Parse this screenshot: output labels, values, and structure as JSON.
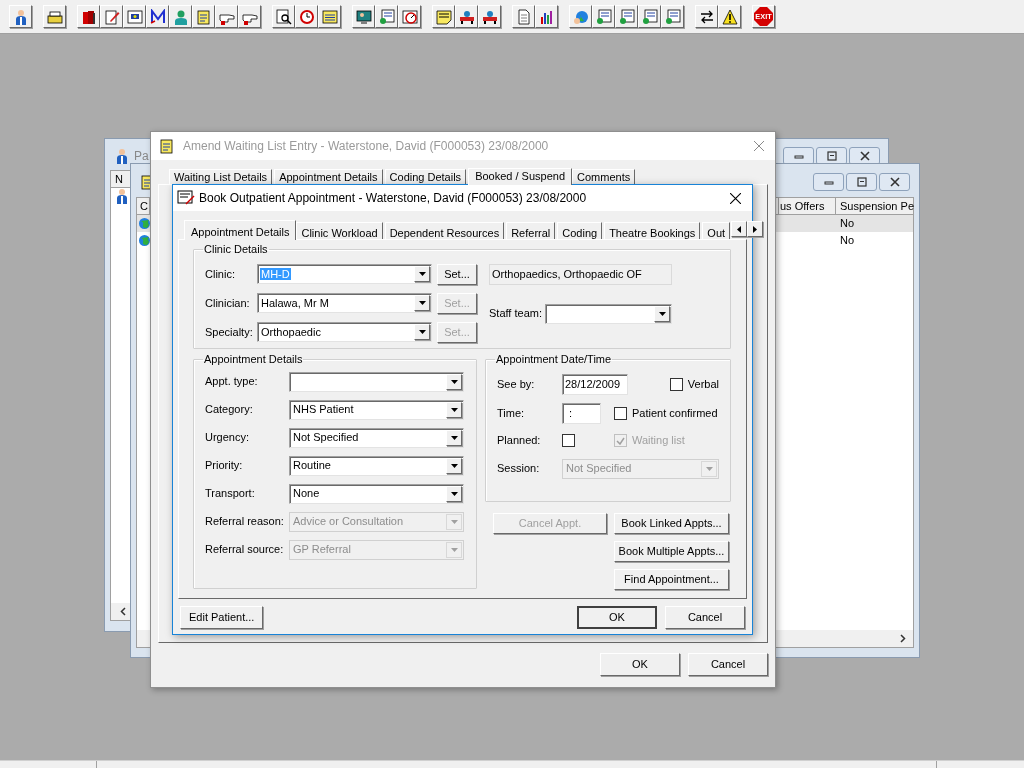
{
  "toolbar": [
    [
      {
        "kind": "person"
      }
    ],
    [
      {
        "kind": "register"
      }
    ],
    [
      {
        "kind": "books"
      },
      {
        "kind": "edit"
      },
      {
        "kind": "scan"
      },
      {
        "kind": "mail"
      },
      {
        "kind": "doctor"
      },
      {
        "kind": "notes"
      },
      {
        "kind": "hand"
      },
      {
        "kind": "hand"
      }
    ],
    [
      {
        "kind": "search"
      },
      {
        "kind": "clock"
      },
      {
        "kind": "list"
      }
    ],
    [
      {
        "kind": "monitor"
      },
      {
        "kind": "form"
      },
      {
        "kind": "gauge"
      }
    ],
    [
      {
        "kind": "note"
      },
      {
        "kind": "bed"
      },
      {
        "kind": "bed"
      }
    ],
    [
      {
        "kind": "document"
      },
      {
        "kind": "chart"
      }
    ],
    [
      {
        "kind": "globe"
      },
      {
        "kind": "form"
      },
      {
        "kind": "form"
      },
      {
        "kind": "form"
      },
      {
        "kind": "form"
      }
    ],
    [
      {
        "kind": "swap"
      },
      {
        "kind": "warning"
      }
    ],
    [
      {
        "kind": "stop",
        "label": "EXIT"
      }
    ]
  ],
  "patient_window": {
    "title": "Pa",
    "columns": [
      "N"
    ],
    "rows": [
      {
        "kind": "person"
      }
    ]
  },
  "list_window": {
    "columns": [
      "C",
      "us Offers",
      "Suspension Pe"
    ],
    "rows": [
      {
        "selected": true,
        "suspension": "No"
      },
      {
        "selected": false,
        "suspension": "No"
      }
    ]
  },
  "amend_window": {
    "title": "Amend Waiting List Entry - Waterstone, David (F000053) 23/08/2000",
    "tabs": [
      {
        "label": "Waiting List Details",
        "selected": false
      },
      {
        "label": "Appointment Details",
        "selected": false
      },
      {
        "label": "Coding Details",
        "selected": false
      },
      {
        "label": "Booked / Suspend",
        "selected": true
      },
      {
        "label": "Comments",
        "selected": false
      }
    ],
    "buttons": [
      {
        "label": "OK"
      },
      {
        "label": "Cancel"
      }
    ]
  },
  "book_dialog": {
    "title": "Book Outpatient Appointment - Waterstone, David (F000053) 23/08/2000",
    "tabs": [
      {
        "label": "Appointment Details",
        "selected": true
      },
      {
        "label": "Clinic Workload",
        "selected": false
      },
      {
        "label": "Dependent Resources",
        "selected": false
      },
      {
        "label": "Referral",
        "selected": false
      },
      {
        "label": "Coding",
        "selected": false
      },
      {
        "label": "Theatre Bookings",
        "selected": false
      },
      {
        "label": "Out",
        "selected": false
      }
    ],
    "clinic_details": {
      "legend": "Clinic Details",
      "fields": [
        {
          "label": "Clinic:",
          "value": "MH-D",
          "text_selected": true,
          "button": {
            "label": "Set...",
            "disabled": false
          }
        },
        {
          "label": "Clinician:",
          "value": "Halawa, Mr M",
          "text_selected": false,
          "button": {
            "label": "Set...",
            "disabled": true
          }
        },
        {
          "label": "Specialty:",
          "value": "Orthopaedic",
          "text_selected": false,
          "button": {
            "label": "Set...",
            "disabled": true
          }
        }
      ],
      "description": "Orthopaedics, Orthopaedic OF",
      "staff_team": {
        "label": "Staff team:"
      }
    },
    "appointment_details": {
      "legend": "Appointment Details",
      "fields": [
        {
          "label": "Appt. type:",
          "disabled": false
        },
        {
          "label": "Category:",
          "value": "NHS Patient",
          "disabled": false
        },
        {
          "label": "Urgency:",
          "value": "Not Specified",
          "disabled": false
        },
        {
          "label": "Priority:",
          "value": "Routine",
          "disabled": false
        },
        {
          "label": "Transport:",
          "value": "None",
          "disabled": false
        },
        {
          "label": "Referral reason:",
          "value": "Advice or Consultation",
          "disabled": true
        },
        {
          "label": "Referral source:",
          "value": "GP Referral",
          "disabled": true
        }
      ]
    },
    "date_time": {
      "legend": "Appointment Date/Time",
      "see_by": {
        "label": "See by:",
        "value": "28/12/2009"
      },
      "verbal": {
        "label": "Verbal",
        "checked": false,
        "disabled": false
      },
      "time": {
        "label": "Time:",
        "value": ":"
      },
      "patient_confirmed": {
        "label": "Patient confirmed",
        "checked": false,
        "disabled": false
      },
      "planned": {
        "label": "Planned:",
        "checked": false,
        "disabled": false
      },
      "waiting_list": {
        "label": "Waiting list",
        "checked": true,
        "disabled": true
      },
      "session": {
        "label": "Session:",
        "value": "Not Specified",
        "disabled": true
      }
    },
    "action_buttons": [
      {
        "label": "Cancel Appt.",
        "disabled": true
      },
      {
        "label": "Book Linked Appts...",
        "disabled": false
      },
      {
        "label": "Book Multiple Appts...",
        "disabled": false
      },
      {
        "label": "Find Appointment...",
        "disabled": false
      }
    ],
    "footer_buttons": [
      {
        "label": "Edit Patient...",
        "default": false
      },
      {
        "label": "OK",
        "default": true
      },
      {
        "label": "Cancel",
        "default": false
      }
    ]
  }
}
